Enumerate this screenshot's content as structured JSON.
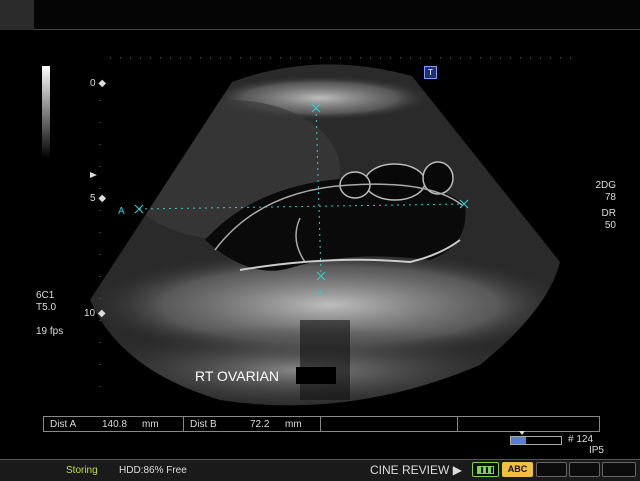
{
  "depth_scale": {
    "marks": [
      "0",
      "5",
      "10"
    ]
  },
  "left_info": {
    "probe": "6C1",
    "setting": "T5.0",
    "frame_rate": "19 fps"
  },
  "right_info": {
    "mode": "2DG",
    "gain": "78",
    "dr_label": "DR",
    "dr_value": "50"
  },
  "measurement_markers": {
    "a_label": "A",
    "b_label": "B"
  },
  "annotation": {
    "text": "RT OVARIAN"
  },
  "orientation_marker": {
    "label": "T"
  },
  "measurements": [
    {
      "name": "Dist A",
      "value": "140.8",
      "unit": "mm"
    },
    {
      "name": "Dist B",
      "value": "72.2",
      "unit": "mm"
    }
  ],
  "cine": {
    "frame": "# 124",
    "preset": "IP5",
    "progress": 0.3
  },
  "status": {
    "storing": "Storing",
    "hdd": "HDD:86% Free",
    "cine_review": "CINE REVIEW"
  },
  "buttons": {
    "abc": "ABC"
  },
  "colors": {
    "caliper": "#37c8cc",
    "storing": "#b8e040",
    "abc_bg": "#f0c040",
    "cine_bar": "#5a7ed8"
  }
}
